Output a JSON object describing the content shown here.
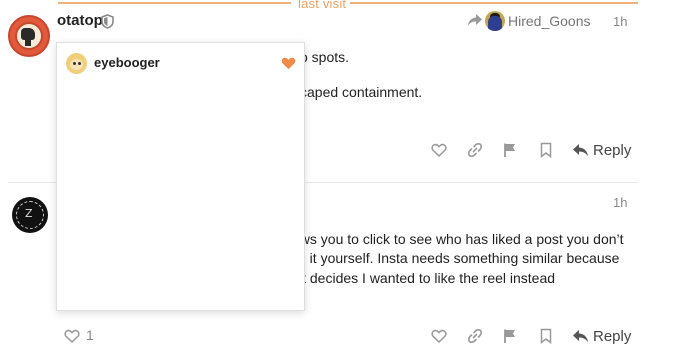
{
  "divider": {
    "label": "last visit"
  },
  "post1": {
    "username": "otatop",
    "reply_to": "Hired_Goons",
    "time": "1h",
    "lines": [
      "o spots.",
      "caped containment."
    ],
    "reply_label": "Reply"
  },
  "post2": {
    "time": "1h",
    "lines": [
      "ows you to click to see who has liked a post you don’t",
      "g it yourself. Insta needs something similar because",
      " it decides I wanted to like the reel instead"
    ],
    "like_count": "1",
    "reply_label": "Reply"
  },
  "likes_popup": {
    "users": [
      {
        "name": "eyebooger"
      }
    ]
  },
  "colors": {
    "accent": "#f08a4b",
    "divider": "#f0b27a",
    "muted": "#888888"
  }
}
